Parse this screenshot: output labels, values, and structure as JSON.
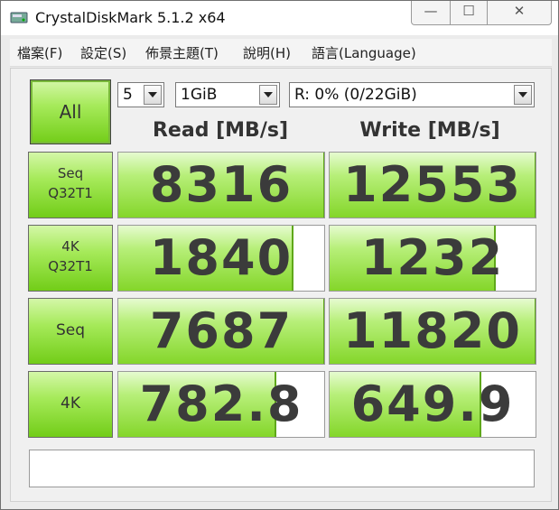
{
  "window": {
    "title": "CrystalDiskMark 5.1.2 x64",
    "min_label": "—",
    "max_label": "☐",
    "close_label": "✕"
  },
  "menu": {
    "items": [
      "檔案(F)",
      "設定(S)",
      "佈景主題(T)",
      "說明(H)",
      "語言(Language)"
    ]
  },
  "controls": {
    "all_label": "All",
    "count": "5",
    "size": "1GiB",
    "drive": "R: 0% (0/22GiB)"
  },
  "headers": {
    "read": "Read [MB/s]",
    "write": "Write [MB/s]"
  },
  "tests": [
    {
      "label1": "Seq",
      "label2": "Q32T1",
      "read": "8316",
      "write": "12553",
      "read_fill": 0.995,
      "write_fill": 0.995
    },
    {
      "label1": "4K",
      "label2": "Q32T1",
      "read": "1840",
      "write": "1232",
      "read_fill": 0.84,
      "write_fill": 0.8
    },
    {
      "label1": "Seq",
      "label2": "",
      "read": "7687",
      "write": "11820",
      "read_fill": 0.995,
      "write_fill": 0.995
    },
    {
      "label1": "4K",
      "label2": "",
      "read": "782.8",
      "write": "649.9",
      "read_fill": 0.76,
      "write_fill": 0.73
    }
  ],
  "comment": "",
  "colors": {
    "fill_green": "#84d62a",
    "button_green": "#72cd18"
  }
}
